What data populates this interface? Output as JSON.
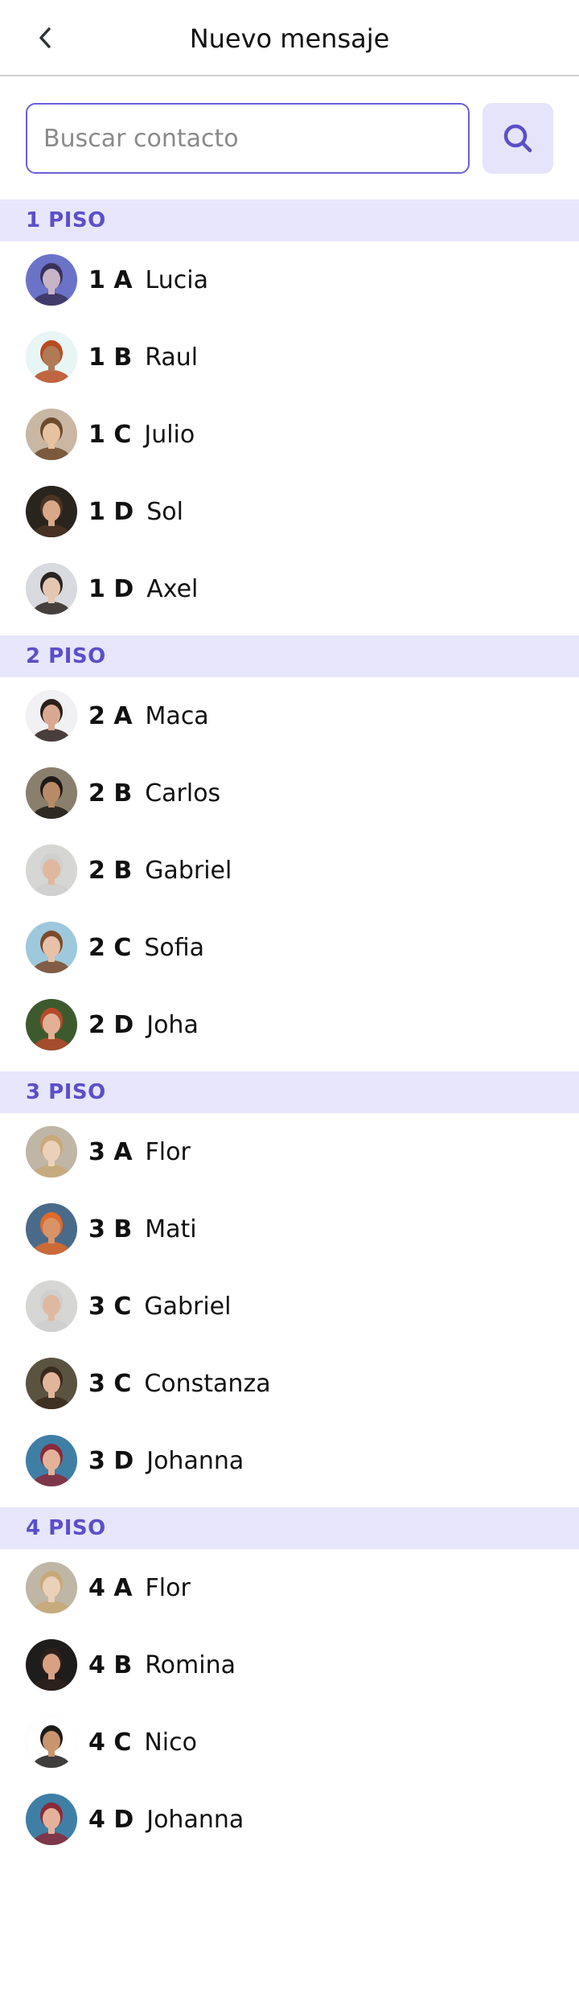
{
  "header": {
    "title": "Nuevo mensaje"
  },
  "search": {
    "placeholder": "Buscar contacto",
    "value": ""
  },
  "sections": [
    {
      "label": "1 PISO",
      "contacts": [
        {
          "unit": "1 A",
          "name": "Lucia",
          "avatar_bg": "#6b73c9",
          "skin": "#c9b3c7",
          "hair": "#3a3159"
        },
        {
          "unit": "1 B",
          "name": "Raul",
          "avatar_bg": "#e7f6f4",
          "skin": "#b07a55",
          "hair": "#b84a22"
        },
        {
          "unit": "1 C",
          "name": "Julio",
          "avatar_bg": "#c9b7a4",
          "skin": "#e7c2a0",
          "hair": "#6e4a2c"
        },
        {
          "unit": "1 D",
          "name": "Sol",
          "avatar_bg": "#2a241f",
          "skin": "#d8a888",
          "hair": "#4b3425"
        },
        {
          "unit": "1 D",
          "name": "Axel",
          "avatar_bg": "#d9dadf",
          "skin": "#e5c7b1",
          "hair": "#2a2522"
        }
      ]
    },
    {
      "label": "2 PISO",
      "contacts": [
        {
          "unit": "2 A",
          "name": "Maca",
          "avatar_bg": "#f1f1f3",
          "skin": "#d9a891",
          "hair": "#2b1e1b"
        },
        {
          "unit": "2 B",
          "name": "Carlos",
          "avatar_bg": "#8a7f6c",
          "skin": "#b98a68",
          "hair": "#1e1a18"
        },
        {
          "unit": "2 B",
          "name": "Gabriel",
          "avatar_bg": "#d6d6d4",
          "skin": "#e0b8a0",
          "hair": "#cfcfcf"
        },
        {
          "unit": "2 C",
          "name": "Sofia",
          "avatar_bg": "#9ec8dc",
          "skin": "#e8c1a8",
          "hair": "#7b4a2c"
        },
        {
          "unit": "2 D",
          "name": "Joha",
          "avatar_bg": "#3d5a2e",
          "skin": "#e2b095",
          "hair": "#b64a2a"
        }
      ]
    },
    {
      "label": "3 PISO",
      "contacts": [
        {
          "unit": "3 A",
          "name": "Flor",
          "avatar_bg": "#bfb6a6",
          "skin": "#ecd1ba",
          "hair": "#c8a978"
        },
        {
          "unit": "3 B",
          "name": "Mati",
          "avatar_bg": "#4a6a8a",
          "skin": "#d89468",
          "hair": "#e06a2a"
        },
        {
          "unit": "3 C",
          "name": "Gabriel",
          "avatar_bg": "#d6d6d4",
          "skin": "#e0b8a0",
          "hair": "#cfcfcf"
        },
        {
          "unit": "3 C",
          "name": "Constanza",
          "avatar_bg": "#5a5340",
          "skin": "#e2b59a",
          "hair": "#3a2a1d"
        },
        {
          "unit": "3 D",
          "name": "Johanna",
          "avatar_bg": "#3f7fa6",
          "skin": "#e4b29a",
          "hair": "#8a2a3a"
        }
      ]
    },
    {
      "label": "4 PISO",
      "contacts": [
        {
          "unit": "4 A",
          "name": "Flor",
          "avatar_bg": "#bfb6a6",
          "skin": "#ecd1ba",
          "hair": "#c8a978"
        },
        {
          "unit": "4 B",
          "name": "Romina",
          "avatar_bg": "#1f1d1c",
          "skin": "#d9a083",
          "hair": "#2e211b"
        },
        {
          "unit": "4 C",
          "name": "Nico",
          "avatar_bg": "#ffffff",
          "skin": "#c9956e",
          "hair": "#1e1c1a"
        },
        {
          "unit": "4 D",
          "name": "Johanna",
          "avatar_bg": "#3f7fa6",
          "skin": "#e4b29a",
          "hair": "#8a2a3a"
        }
      ]
    }
  ],
  "colors": {
    "accent": "#5b4fc9",
    "section_bg": "#e7e6fd",
    "search_border": "#6a5fd9",
    "search_button_bg": "#e6e4fb"
  },
  "icons": {
    "back": "chevron-left-icon",
    "search": "search-icon"
  }
}
